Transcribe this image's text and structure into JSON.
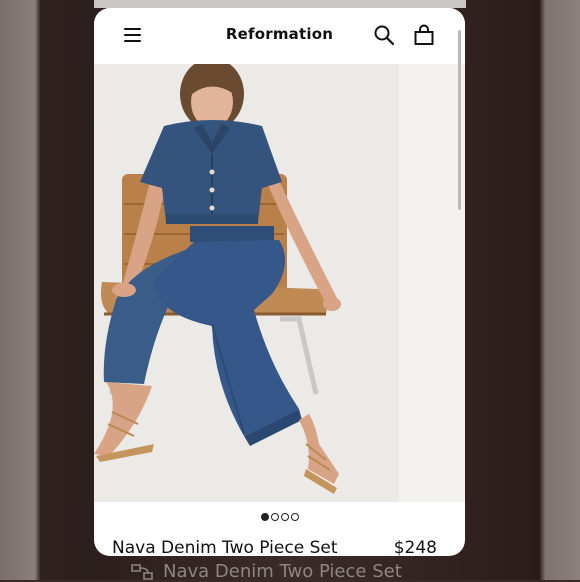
{
  "header": {
    "brand": "Reformation",
    "menu_icon": "hamburger-menu-icon",
    "search_icon": "search-icon",
    "bag_icon": "shopping-bag-icon"
  },
  "product": {
    "image_alt": "Nava Denim Two Piece Set",
    "carousel": {
      "total": 4,
      "active": 1
    },
    "name": "Nava Denim Two Piece Set",
    "price": "$248"
  },
  "caption": {
    "icon": "brand-logo-icon",
    "text": "Nava Denim Two Piece Set"
  },
  "colors": {
    "denim": "#34547e",
    "chair": "#b9804a",
    "photo_bg": "#eceae7",
    "frame": "#3a2a27"
  }
}
